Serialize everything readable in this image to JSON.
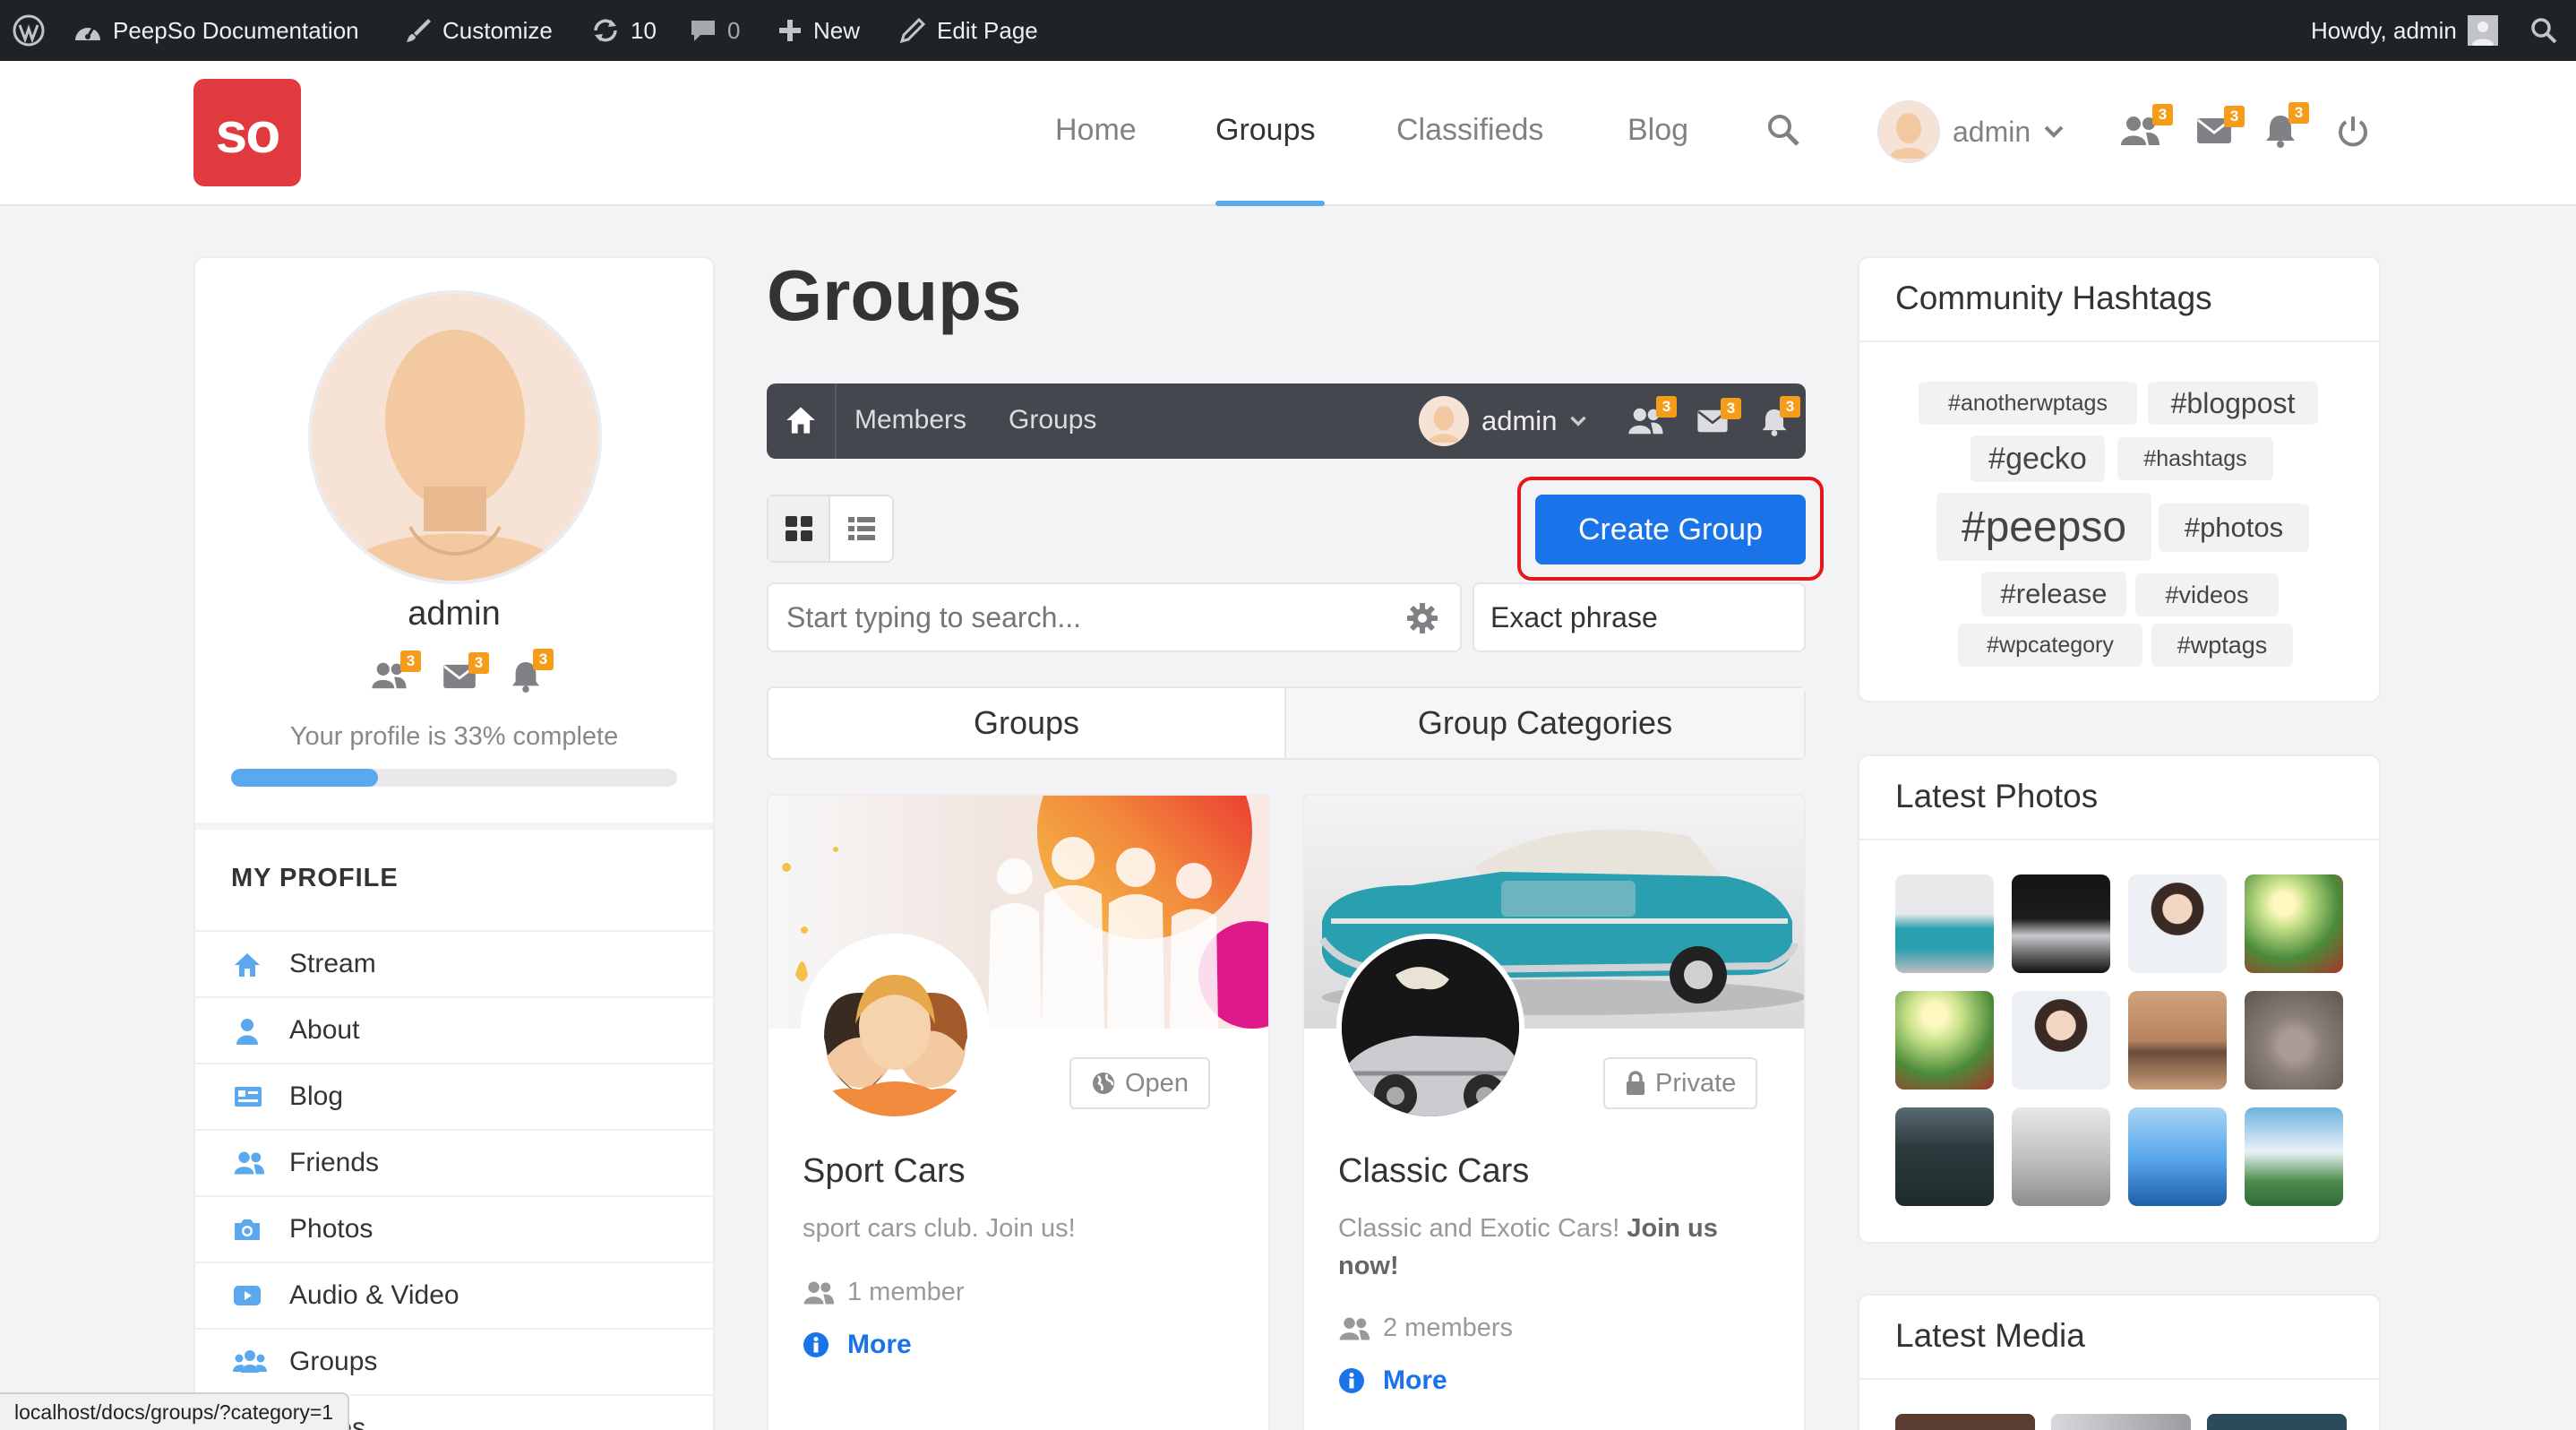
{
  "adminbar": {
    "site_name": "PeepSo Documentation",
    "customize": "Customize",
    "updates_count": "10",
    "comments_count": "0",
    "new": "New",
    "edit_page": "Edit Page",
    "howdy": "Howdy, admin"
  },
  "header": {
    "logo_text": "SO",
    "nav": [
      "Home",
      "Groups",
      "Classifieds",
      "Blog"
    ],
    "active_nav": "Groups",
    "user_name": "admin",
    "badges": {
      "friends": "3",
      "messages": "3",
      "notifications": "3"
    }
  },
  "profile": {
    "name": "admin",
    "badges": {
      "friends": "3",
      "messages": "3",
      "notifications": "3"
    },
    "completion_text": "Your profile is 33% complete",
    "completion_percent": 33,
    "section_title": "MY PROFILE",
    "menu": [
      "Stream",
      "About",
      "Blog",
      "Friends",
      "Photos",
      "Audio & Video",
      "Groups",
      "Pages"
    ]
  },
  "main": {
    "title": "Groups",
    "toolbar": {
      "members": "Members",
      "groups": "Groups",
      "user": "admin",
      "badges": {
        "friends": "3",
        "messages": "3",
        "notifications": "3"
      }
    },
    "create_button": "Create Group",
    "search_placeholder": "Start typing to search...",
    "search_mode": "Exact phrase",
    "tabs": [
      "Groups",
      "Group Categories"
    ],
    "groups": [
      {
        "privacy": "Open",
        "name": "Sport Cars",
        "description": "sport cars club. Join us!",
        "description_bold": "",
        "members": "1 member",
        "more": "More"
      },
      {
        "privacy": "Private",
        "name": "Classic Cars",
        "description": "Classic and Exotic Cars! ",
        "description_bold": "Join us now!",
        "members": "2 members",
        "more": "More"
      }
    ]
  },
  "right": {
    "hashtags_title": "Community Hashtags",
    "hashtags": [
      "#anotherwptags",
      "#blogpost",
      "#gecko",
      "#hashtags",
      "#peepso",
      "#photos",
      "#release",
      "#videos",
      "#wpcategory",
      "#wptags"
    ],
    "photos_title": "Latest Photos",
    "media_title": "Latest Media"
  },
  "statusbar": {
    "url": "localhost/docs/groups/?category=1"
  },
  "colors": {
    "accent": "#1a73e8",
    "brand_red": "#e0393e",
    "badge": "#f59c1a",
    "highlight": "#e5171c",
    "progress": "#5aa9ee"
  }
}
